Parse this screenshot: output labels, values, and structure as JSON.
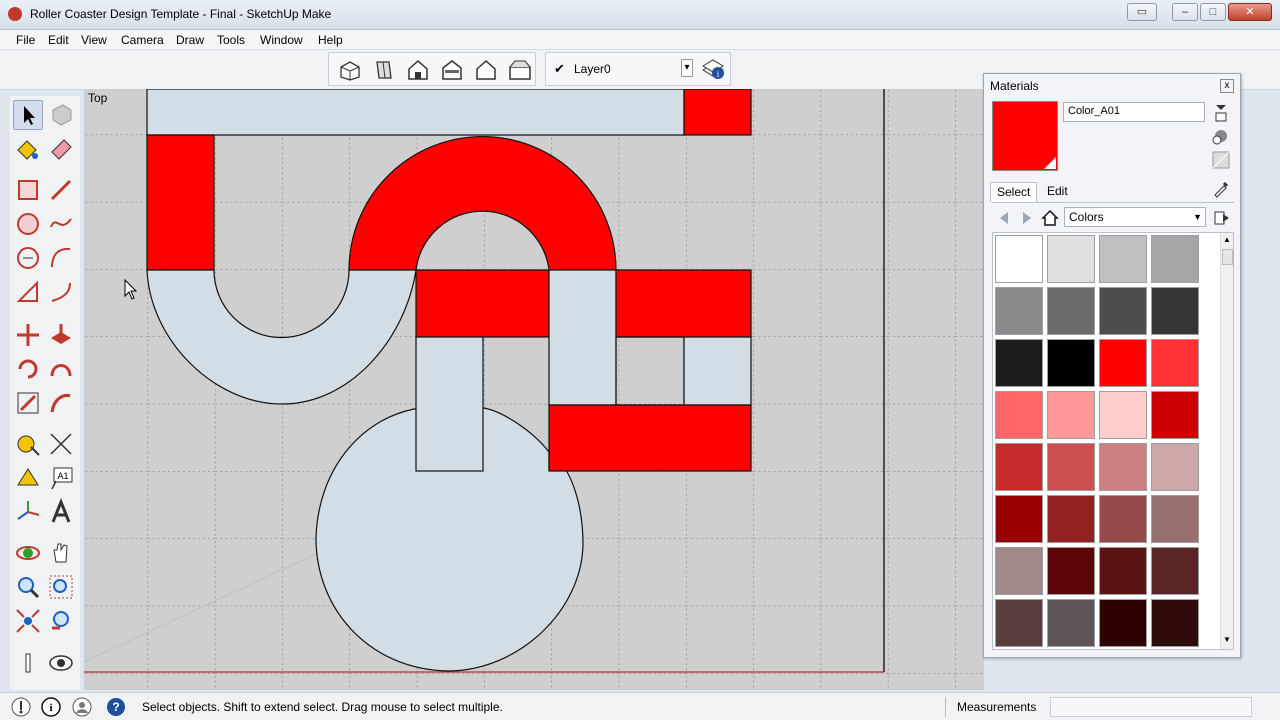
{
  "window": {
    "title": "Roller Coaster Design Template - Final - SketchUp Make",
    "minimize": "▭",
    "maximize": "□",
    "restore": "–",
    "close": "✕"
  },
  "menu": [
    "File",
    "Edit",
    "View",
    "Camera",
    "Draw",
    "Tools",
    "Window",
    "Help"
  ],
  "toolbar": {
    "views": [
      "iso-view-icon",
      "top-view-icon",
      "front-view-icon",
      "right-view-icon",
      "back-view-icon",
      "left-view-icon"
    ],
    "layer": {
      "check": "✔",
      "name": "Layer0",
      "arrow": "▾"
    }
  },
  "viewport": {
    "label": "Top",
    "colors": {
      "red": "#ff0000",
      "track": "#d3dde5",
      "ground": "#cfcfcf"
    }
  },
  "status": {
    "hint": "Select objects. Shift to extend select. Drag mouse to select multiple.",
    "measurements_label": "Measurements",
    "measurements_value": ""
  },
  "materials": {
    "title": "Materials",
    "close": "x",
    "current_name": "Color_A01",
    "current_color": "#ff0000",
    "tabs": [
      "Select",
      "Edit"
    ],
    "library": "Colors",
    "swatches": [
      "#ffffff",
      "#e0e0e0",
      "#c0c0c0",
      "#a6a6a6",
      "#8a8a8a",
      "#6b6b6b",
      "#4d4d4d",
      "#363636",
      "#1c1c1c",
      "#000000",
      "#ff0000",
      "#ff3333",
      "#ff6666",
      "#ff9999",
      "#ffcccc",
      "#cc0000",
      "#c82a2a",
      "#cc5050",
      "#cc8080",
      "#cca8a8",
      "#990000",
      "#922222",
      "#954949",
      "#997070",
      "#a08888",
      "#5b0505",
      "#5b1414",
      "#5b2525",
      "#5b3d3d",
      "#5e5656",
      "#2e0000",
      "#2e0a0a"
    ]
  }
}
